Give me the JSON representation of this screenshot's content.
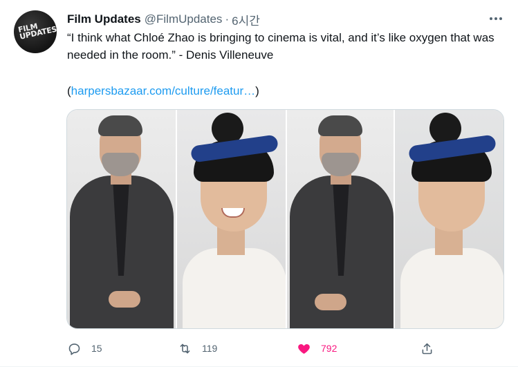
{
  "tweet": {
    "display_name": "Film Updates",
    "handle": "@FilmUpdates",
    "separator": "·",
    "time": "6시간",
    "avatar_text_line1": "FILM",
    "avatar_text_line2": "UPDATES",
    "text": "“I think what Chloé Zhao is bringing to cinema is vital, and it’s like oxygen that was needed in the room.” - Denis Villeneuve",
    "link_open": "(",
    "link_text": "harpersbazaar.com/culture/featur…",
    "link_close": ")"
  },
  "actions": {
    "reply_count": "15",
    "retweet_count": "119",
    "like_count": "792"
  },
  "colors": {
    "link": "#1d9bf0",
    "like": "#f91880",
    "muted": "#536471"
  },
  "icons": [
    "more-icon",
    "reply-icon",
    "retweet-icon",
    "heart-icon",
    "share-icon"
  ]
}
